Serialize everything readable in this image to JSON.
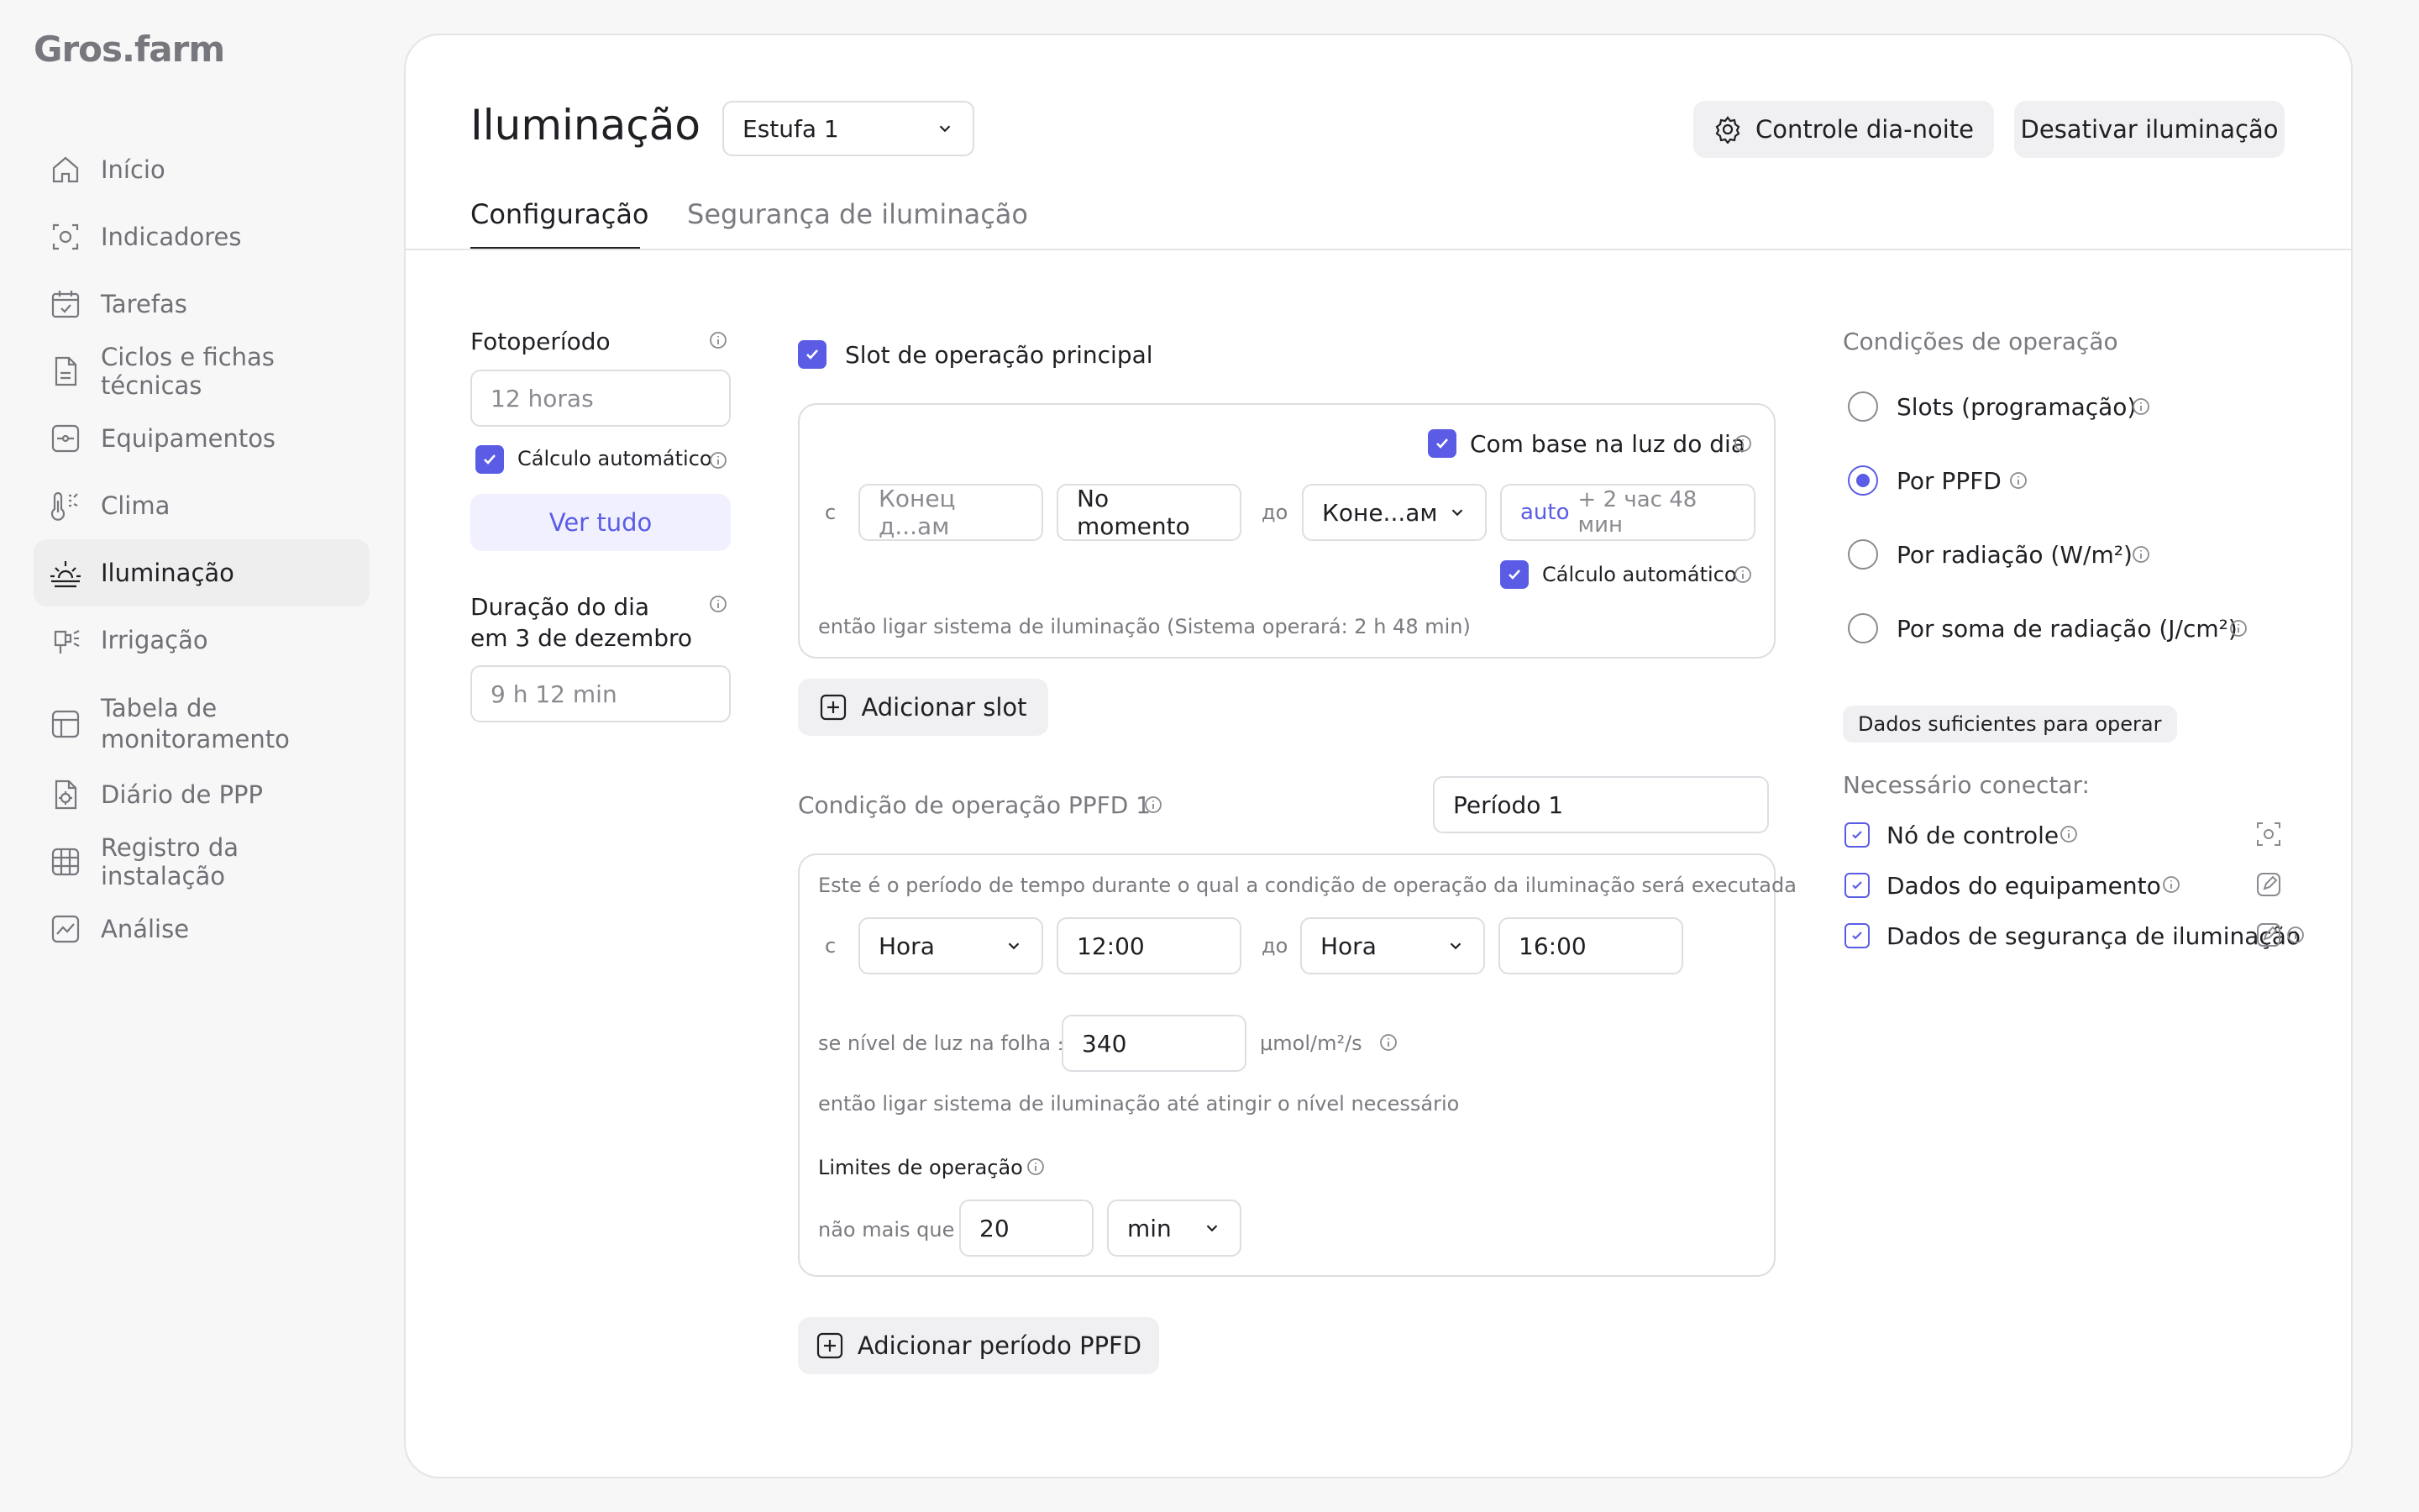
{
  "brand": {
    "logo": "Gros.farm"
  },
  "sidebar": {
    "items": [
      {
        "label": "Início",
        "icon": "home-icon"
      },
      {
        "label": "Indicadores",
        "icon": "indicators-icon"
      },
      {
        "label": "Tarefas",
        "icon": "calendar-icon"
      },
      {
        "label": "Ciclos e fichas técnicas",
        "icon": "document-icon"
      },
      {
        "label": "Equipamentos",
        "icon": "equipment-icon"
      },
      {
        "label": "Clima",
        "icon": "thermometer-icon"
      },
      {
        "label": "Iluminação",
        "icon": "sunrise-icon",
        "active": true
      },
      {
        "label": "Irrigação",
        "icon": "sprinkler-icon"
      },
      {
        "label": "Tabela de monitoramento",
        "line1": "Tabela de",
        "line2": "monitoramento",
        "icon": "table-icon"
      },
      {
        "label": "Diário de PPP",
        "icon": "journal-icon"
      },
      {
        "label": "Registro da instalação",
        "icon": "grid-icon"
      },
      {
        "label": "Análise",
        "icon": "chart-icon"
      }
    ]
  },
  "header": {
    "title": "Iluminação",
    "greenhouse_select": "Estufa 1",
    "day_night_button": "Controle dia-noite",
    "disable_button": "Desativar iluminação"
  },
  "tabs": [
    {
      "label": "Configuração",
      "active": true
    },
    {
      "label": "Segurança de iluminação",
      "active": false
    }
  ],
  "left": {
    "photoperiod_label": "Fotoperíodo",
    "photoperiod_placeholder": "12 horas",
    "auto_calc_label": "Cálculo automático",
    "see_all_button": "Ver tudo",
    "day_length_line1": "Duração do dia",
    "day_length_line2": "em 3 de dezembro",
    "day_length_value": "9 h 12 min"
  },
  "slot": {
    "main_slot_label": "Slot de operação principal",
    "daylight_label": "Com base na luz do dia",
    "from_prefix": "с",
    "from_field": "Конец д...ам",
    "moment_field": "No momento",
    "to_prefix": "до",
    "to_field": "Коне...ам",
    "auto_word": "auto",
    "auto_offset": "+ 2 час 48 мин",
    "auto_calc_label": "Cálculo automático",
    "note": "então ligar sistema de iluminação (Sistema operará: 2 h 48 min)",
    "add_slot_button": "Adicionar slot"
  },
  "ppfd": {
    "title": "Condição de operação PPFD 1",
    "period_field": "Período 1",
    "description": "Este é o período de tempo durante o qual a condição de operação da iluminação será executada",
    "from_prefix": "с",
    "from_unit": "Hora",
    "from_time": "12:00",
    "to_prefix": "до",
    "to_unit": "Hora",
    "to_time": "16:00",
    "light_level_label": "se nível de luz na folha ≤",
    "light_level_value": "340",
    "light_level_unit": "μmol/m²/s",
    "then_note": "então ligar sistema de iluminação até atingir o nível necessário",
    "limits_label": "Limites de operação",
    "no_more_than": "não mais que",
    "limit_value": "20",
    "limit_unit": "min",
    "add_period_button": "Adicionar período PPFD"
  },
  "conditions": {
    "title": "Condições de operação",
    "options": [
      {
        "label": "Slots (programação)",
        "selected": false
      },
      {
        "label": "Por PPFD",
        "selected": true
      },
      {
        "label": "Por radiação (W/m²)",
        "selected": false
      },
      {
        "label": "Por soma de radiação (J/cm²)",
        "selected": false
      }
    ],
    "badge": "Dados suficientes para operar",
    "need_connect": "Necessário conectar:",
    "requirements": [
      {
        "label": "Nó de controle",
        "icon": "node-icon"
      },
      {
        "label": "Dados do equipamento",
        "icon": "edit-icon"
      },
      {
        "label": "Dados de segurança de iluminação",
        "icon": "edit-icon"
      }
    ]
  },
  "colors": {
    "accent": "#5a5ce6",
    "accent_light": "#f0f0fe",
    "panel": "#ffffff",
    "background": "#f7f7f7"
  }
}
